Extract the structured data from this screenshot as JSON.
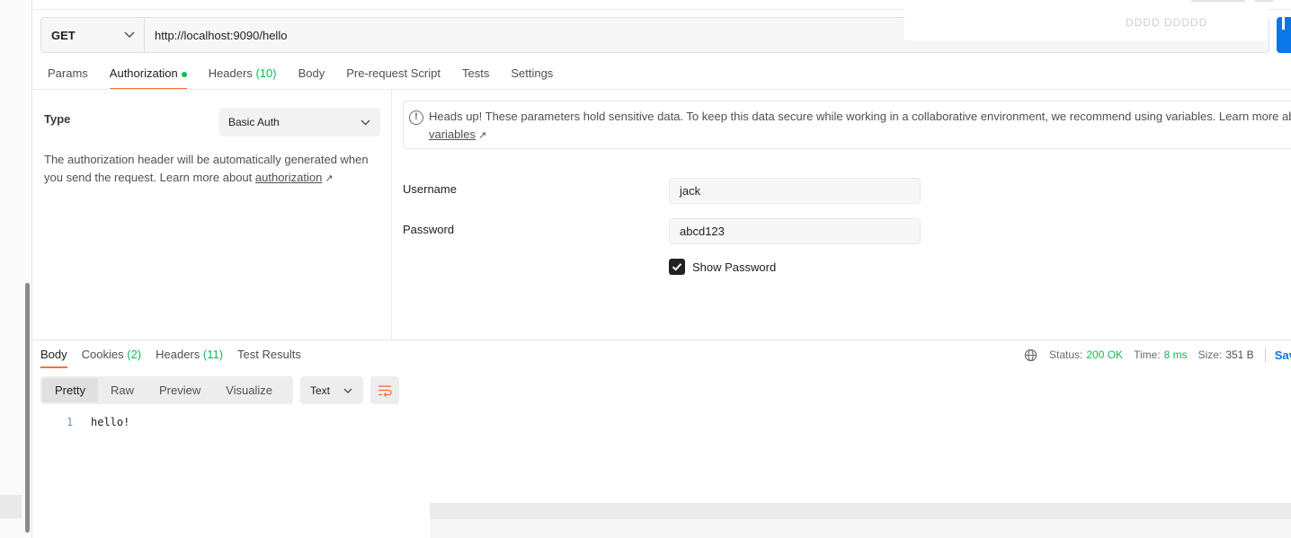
{
  "request": {
    "method": "GET",
    "url": "http://localhost:9090/hello",
    "overlay_text": "DDDD DDDDD"
  },
  "request_tabs": [
    {
      "label": "Params",
      "count": "",
      "dot": false,
      "active": false
    },
    {
      "label": "Authorization",
      "count": "",
      "dot": true,
      "active": true
    },
    {
      "label": "Headers",
      "count": "(10)",
      "dot": false,
      "active": false
    },
    {
      "label": "Body",
      "count": "",
      "dot": false,
      "active": false
    },
    {
      "label": "Pre-request Script",
      "count": "",
      "dot": false,
      "active": false
    },
    {
      "label": "Tests",
      "count": "",
      "dot": false,
      "active": false
    },
    {
      "label": "Settings",
      "count": "",
      "dot": false,
      "active": false
    }
  ],
  "auth": {
    "type_label": "Type",
    "type_value": "Basic Auth",
    "description": "The authorization header will be automatically generated when you send the request. Learn more about",
    "description_link": "authorization",
    "notice_text": "Heads up! These parameters hold sensitive data. To keep this data secure while working in a collaborative environment, we recommend using variables. Learn more about",
    "notice_link": "variables",
    "username_label": "Username",
    "username_value": "jack",
    "password_label": "Password",
    "password_value": "abcd123",
    "show_password_label": "Show Password"
  },
  "response_tabs": [
    {
      "label": "Body",
      "count": "",
      "active": true
    },
    {
      "label": "Cookies",
      "count": "(2)",
      "active": false
    },
    {
      "label": "Headers",
      "count": "(11)",
      "active": false
    },
    {
      "label": "Test Results",
      "count": "",
      "active": false
    }
  ],
  "status": {
    "status_label": "Status:",
    "status_value": "200 OK",
    "time_label": "Time:",
    "time_value": "8 ms",
    "size_label": "Size:",
    "size_value": "351 B",
    "save_label": "Save"
  },
  "view_modes": [
    {
      "label": "Pretty",
      "active": true
    },
    {
      "label": "Raw",
      "active": false
    },
    {
      "label": "Preview",
      "active": false
    },
    {
      "label": "Visualize",
      "active": false
    }
  ],
  "format_value": "Text",
  "response_body": [
    {
      "line": "1",
      "text": "hello!"
    }
  ],
  "colors": {
    "accent": "#ff6c37",
    "success": "#0cbb52",
    "primary": "#0a76e8"
  }
}
